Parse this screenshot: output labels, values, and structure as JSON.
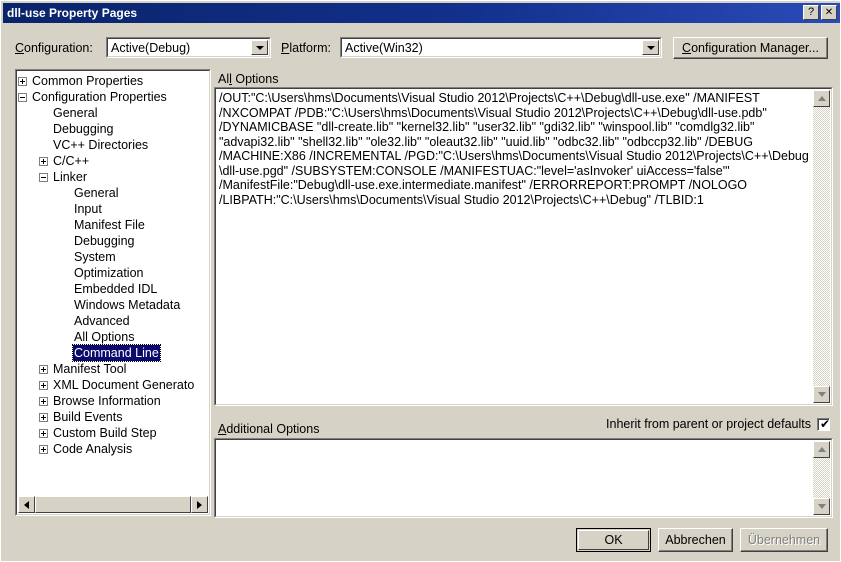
{
  "window": {
    "title": "dll-use Property Pages",
    "help_button": "?",
    "close_button": "✕"
  },
  "toolbar": {
    "configuration_label": "Configuration:",
    "configuration_value": "Active(Debug)",
    "platform_label": "Platform:",
    "platform_value": "Active(Win32)",
    "configuration_manager_label": "Configuration Manager..."
  },
  "tree": {
    "selected": "Command Line",
    "nodes": [
      {
        "label": "Common Properties",
        "indent": 0,
        "expander": "plus"
      },
      {
        "label": "Configuration Properties",
        "indent": 0,
        "expander": "minus"
      },
      {
        "label": "General",
        "indent": 1,
        "expander": "none"
      },
      {
        "label": "Debugging",
        "indent": 1,
        "expander": "none"
      },
      {
        "label": "VC++ Directories",
        "indent": 1,
        "expander": "none"
      },
      {
        "label": "C/C++",
        "indent": 1,
        "expander": "plus"
      },
      {
        "label": "Linker",
        "indent": 1,
        "expander": "minus"
      },
      {
        "label": "General",
        "indent": 2,
        "expander": "none"
      },
      {
        "label": "Input",
        "indent": 2,
        "expander": "none"
      },
      {
        "label": "Manifest File",
        "indent": 2,
        "expander": "none"
      },
      {
        "label": "Debugging",
        "indent": 2,
        "expander": "none"
      },
      {
        "label": "System",
        "indent": 2,
        "expander": "none"
      },
      {
        "label": "Optimization",
        "indent": 2,
        "expander": "none"
      },
      {
        "label": "Embedded IDL",
        "indent": 2,
        "expander": "none"
      },
      {
        "label": "Windows Metadata",
        "indent": 2,
        "expander": "none"
      },
      {
        "label": "Advanced",
        "indent": 2,
        "expander": "none"
      },
      {
        "label": "All Options",
        "indent": 2,
        "expander": "none"
      },
      {
        "label": "Command Line",
        "indent": 2,
        "expander": "none",
        "selected": true
      },
      {
        "label": "Manifest Tool",
        "indent": 1,
        "expander": "plus"
      },
      {
        "label": "XML Document Generato",
        "indent": 1,
        "expander": "plus"
      },
      {
        "label": "Browse Information",
        "indent": 1,
        "expander": "plus"
      },
      {
        "label": "Build Events",
        "indent": 1,
        "expander": "plus"
      },
      {
        "label": "Custom Build Step",
        "indent": 1,
        "expander": "plus"
      },
      {
        "label": "Code Analysis",
        "indent": 1,
        "expander": "plus"
      }
    ]
  },
  "all_options": {
    "label": "All Options",
    "text": "/OUT:\"C:\\Users\\hms\\Documents\\Visual Studio 2012\\Projects\\C++\\Debug\\dll-use.exe\" /MANIFEST\n/NXCOMPAT /PDB:\"C:\\Users\\hms\\Documents\\Visual Studio 2012\\Projects\\C++\\Debug\\dll-use.pdb\"\n/DYNAMICBASE \"dll-create.lib\" \"kernel32.lib\" \"user32.lib\" \"gdi32.lib\" \"winspool.lib\" \"comdlg32.lib\"\n\"advapi32.lib\" \"shell32.lib\" \"ole32.lib\" \"oleaut32.lib\" \"uuid.lib\" \"odbc32.lib\" \"odbccp32.lib\" /DEBUG\n/MACHINE:X86 /INCREMENTAL /PGD:\"C:\\Users\\hms\\Documents\\Visual Studio 2012\\Projects\\C++\\Debug\n\\dll-use.pgd\" /SUBSYSTEM:CONSOLE /MANIFESTUAC:\"level='asInvoker' uiAccess='false'\"\n/ManifestFile:\"Debug\\dll-use.exe.intermediate.manifest\" /ERRORREPORT:PROMPT /NOLOGO\n/LIBPATH:\"C:\\Users\\hms\\Documents\\Visual Studio 2012\\Projects\\C++\\Debug\" /TLBID:1"
  },
  "additional_options": {
    "label": "Additional Options",
    "value": "",
    "inherit_label": "Inherit from parent or project defaults",
    "inherit_checked": "✔"
  },
  "buttons": {
    "ok": "OK",
    "cancel": "Abbrechen",
    "apply": "Übernehmen"
  },
  "colors": {
    "title_bar_start": "#0a246a",
    "title_bar_end": "#2a4bb8",
    "dialog_face": "#d6d2c6",
    "selection": "#0a0a6e",
    "disabled_text": "#808080"
  }
}
